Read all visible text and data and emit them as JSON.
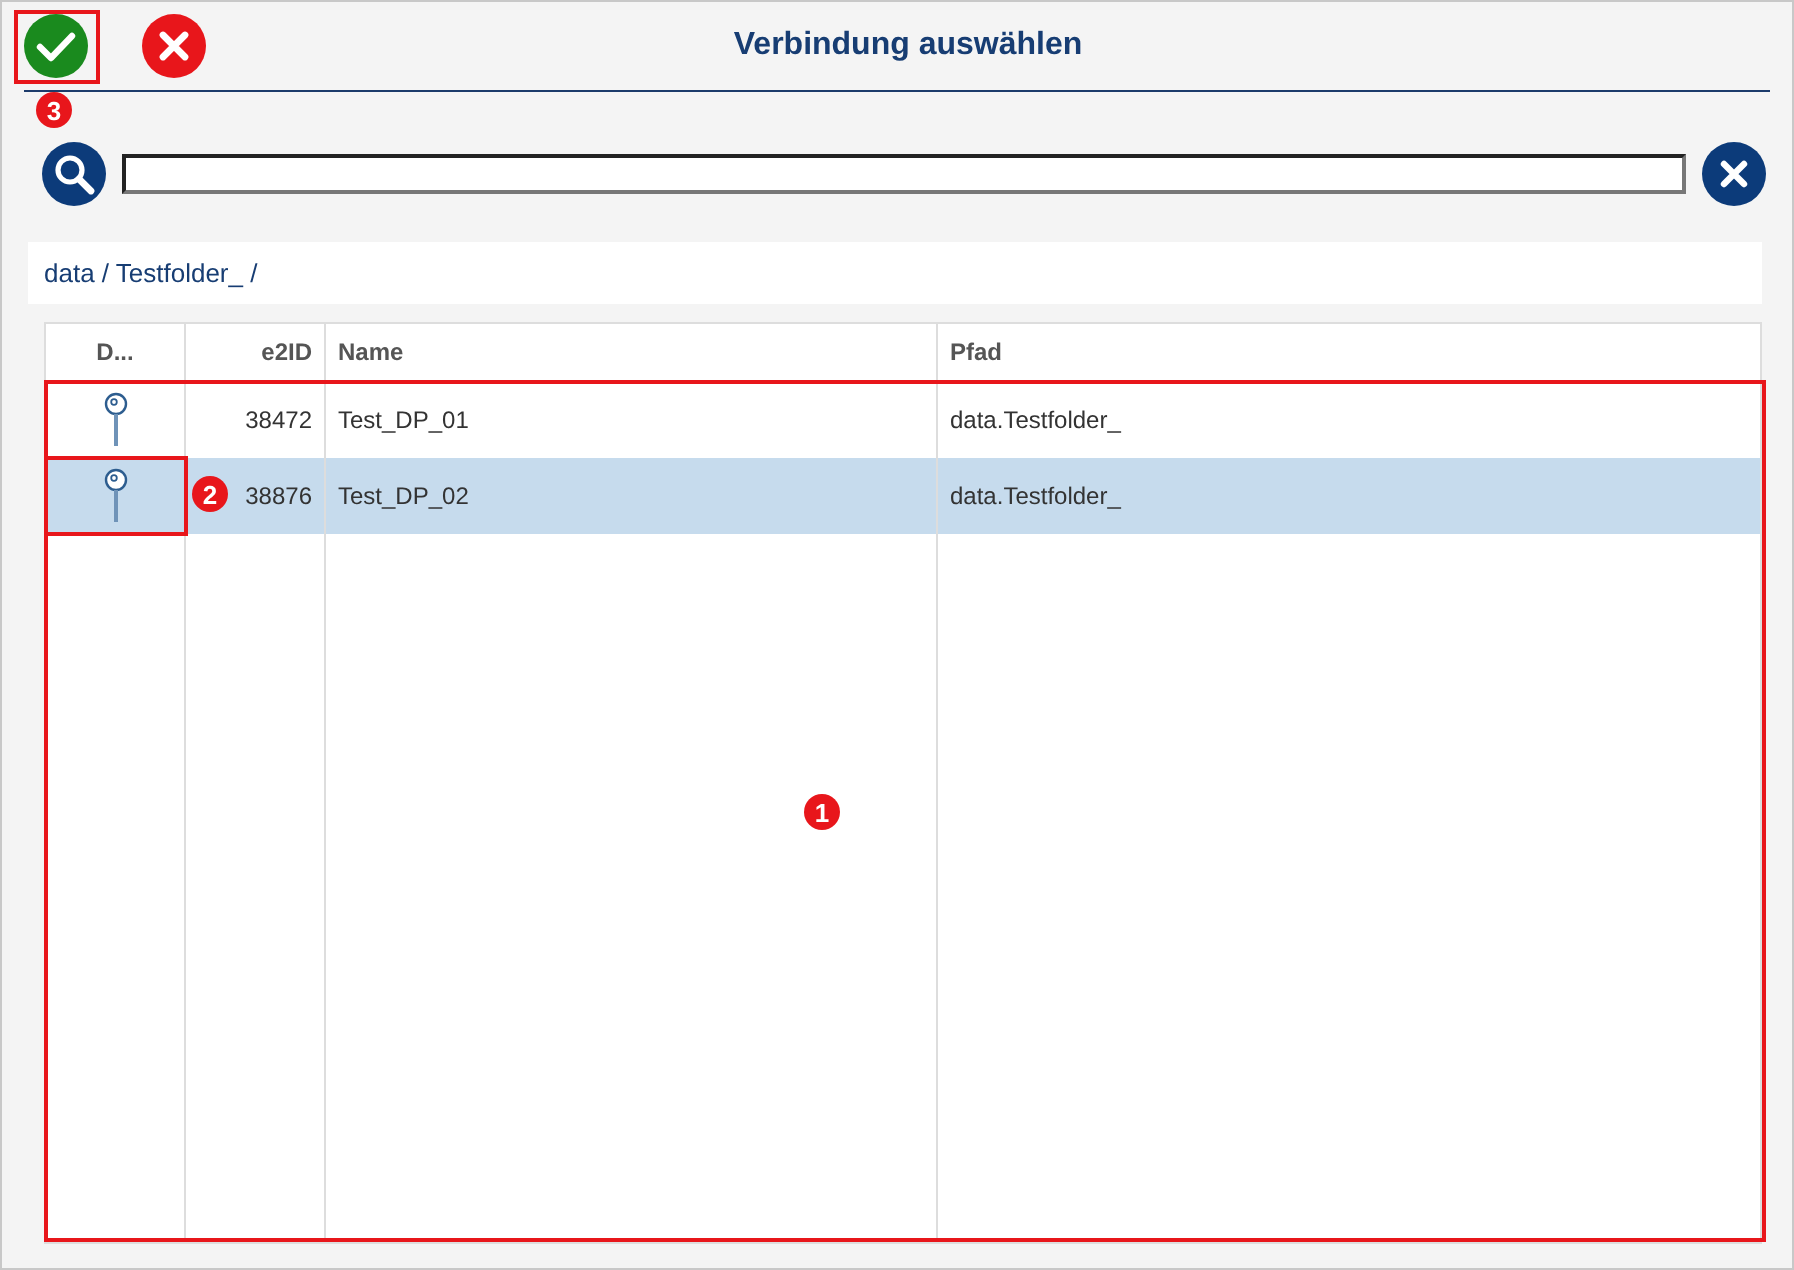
{
  "window": {
    "title": "Verbindung auswählen"
  },
  "breadcrumb": "data / Testfolder_ /",
  "table": {
    "columns": [
      "D...",
      "e2ID",
      "Name",
      "Pfad"
    ],
    "rows": [
      {
        "e2id": "38472",
        "name": "Test_DP_01",
        "path": "data.Testfolder_",
        "selected": false
      },
      {
        "e2id": "38876",
        "name": "Test_DP_02",
        "path": "data.Testfolder_",
        "selected": true
      }
    ]
  },
  "annotations": [
    {
      "label": "1"
    },
    {
      "label": "2"
    },
    {
      "label": "3"
    }
  ]
}
